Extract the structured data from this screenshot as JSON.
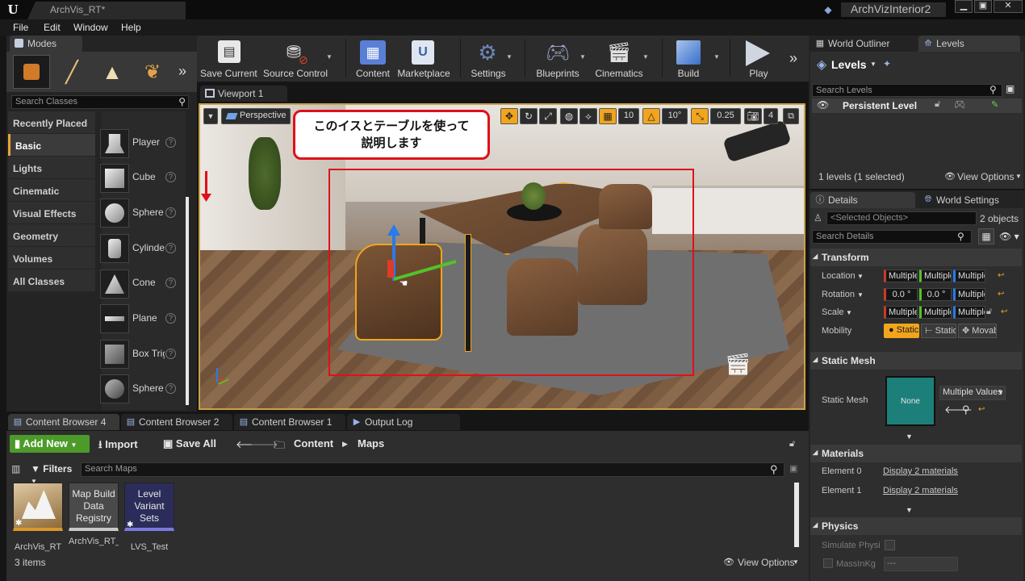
{
  "window": {
    "tab_title": "ArchVis_RT*",
    "project_name": "ArchVizInterior2",
    "minimize": "▁",
    "maximize": "▣",
    "close": "✕"
  },
  "menu": [
    "File",
    "Edit",
    "Window",
    "Help"
  ],
  "modes": {
    "tab_label": "Modes",
    "search_placeholder": "Search Classes",
    "categories": [
      "Recently Placed",
      "Basic",
      "Lights",
      "Cinematic",
      "Visual Effects",
      "Geometry",
      "Volumes",
      "All Classes"
    ],
    "items": [
      "Player",
      "Cube",
      "Sphere",
      "Cylinder",
      "Cone",
      "Plane",
      "Box Trigger",
      "Sphere Trigger"
    ]
  },
  "toolbar": {
    "save_current": "Save Current",
    "source_control": "Source Control",
    "content": "Content",
    "marketplace": "Marketplace",
    "settings": "Settings",
    "blueprints": "Blueprints",
    "cinematics": "Cinematics",
    "build": "Build",
    "play": "Play",
    "more": "»"
  },
  "viewport": {
    "tab_label": "Viewport 1",
    "perspective": "Perspective",
    "grid_snap": "10",
    "rotation_snap": "10°",
    "scale_snap": "0.25",
    "camera_speed": "4",
    "callout": "このイスとテーブルを使って\n説明します"
  },
  "world_outliner": {
    "tab_label": "World Outliner",
    "levels_tab": "Levels",
    "levels_title": "Levels",
    "search_placeholder": "Search Levels",
    "persistent_level": "Persistent Level",
    "count": "1 levels (1 selected)",
    "view_options": "View Options"
  },
  "details": {
    "tab_label": "Details",
    "world_settings_tab": "World Settings",
    "selected_objects": "<Selected Objects>",
    "object_count": "2 objects",
    "search_placeholder": "Search Details",
    "transform_header": "Transform",
    "location_label": "Location",
    "rotation_label": "Rotation",
    "scale_label": "Scale",
    "mobility_label": "Mobility",
    "multiple": "Multiple Values",
    "rot_x": "0.0 °",
    "rot_y": "0.0 °",
    "mob_static": "Static",
    "mob_stationary": "Stationary",
    "mob_movable": "Movable",
    "static_mesh_header": "Static Mesh",
    "static_mesh_label": "Static Mesh",
    "mesh_none": "None",
    "mesh_value": "Multiple Values",
    "materials_header": "Materials",
    "element0": "Element 0",
    "element1": "Element 1",
    "display_materials": "Display 2 materials",
    "physics_header": "Physics",
    "simulate_physics": "Simulate Physics",
    "mass_in_kg": "MassInKg",
    "mass_value": "---"
  },
  "content_browser": {
    "tabs": [
      "Content Browser 4",
      "Content Browser 2",
      "Content Browser 1",
      "Output Log"
    ],
    "add_new": "Add New",
    "import": "Import",
    "save_all": "Save All",
    "path_content": "Content",
    "path_maps": "Maps",
    "filters": "Filters",
    "search_placeholder": "Search Maps",
    "assets": [
      {
        "tile": "",
        "name": "ArchVis_RT"
      },
      {
        "tile": "Map Build Data Registry",
        "name": "ArchVis_RT_BuiltData"
      },
      {
        "tile": "Level Variant Sets",
        "name": "LVS_Test"
      }
    ],
    "item_count": "3 items",
    "view_options": "View Options"
  },
  "colors": {
    "accent_orange": "#f2a51c",
    "add_new_green": "#4c9b2a",
    "annotation_red": "#e0101a",
    "selection_blue": "#3a6ea5"
  }
}
